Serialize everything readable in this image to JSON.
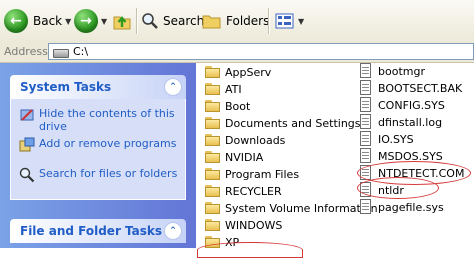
{
  "toolbar": {
    "back_label": "Back",
    "search_label": "Search",
    "folders_label": "Folders"
  },
  "address": {
    "label": "Address",
    "path": "C:\\"
  },
  "sidebar": {
    "system_tasks": {
      "title": "System Tasks",
      "items": [
        {
          "label": "Hide the contents of this drive",
          "icon": "hide-icon"
        },
        {
          "label": "Add or remove programs",
          "icon": "add-remove-icon"
        },
        {
          "label": "Search for files or folders",
          "icon": "search-icon"
        }
      ]
    },
    "file_tasks": {
      "title": "File and Folder Tasks"
    }
  },
  "folders": [
    "AppServ",
    "ATI",
    "Boot",
    "Documents and Settings",
    "Downloads",
    "NVIDIA",
    "Program Files",
    "RECYCLER",
    "System Volume Information",
    "WINDOWS",
    "XP"
  ],
  "files": [
    "bootmgr",
    "BOOTSECT.BAK",
    "CONFIG.SYS",
    "dfinstall.log",
    "IO.SYS",
    "MSDOS.SYS",
    "NTDETECT.COM",
    "ntldr",
    "pagefile.sys"
  ],
  "highlighted_files": [
    "NTDETECT.COM",
    "ntldr"
  ],
  "colors": {
    "highlight_ring": "#d53a3a",
    "task_link": "#215dc6",
    "sidebar": "#7ba2e7"
  }
}
